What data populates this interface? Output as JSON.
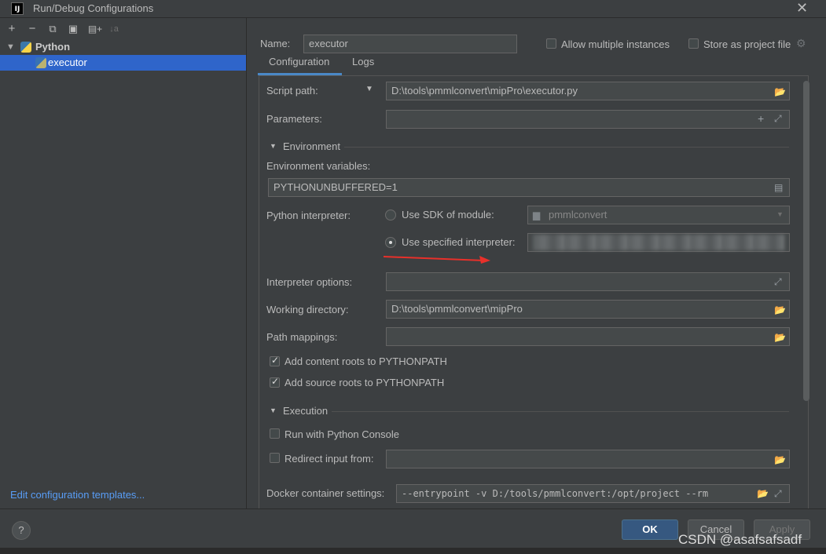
{
  "window": {
    "title": "Run/Debug Configurations",
    "app_icon": "IJ"
  },
  "toolbar": {
    "add": "+",
    "remove": "−",
    "copy": "⧉",
    "save": "▣",
    "folder": "▤+",
    "sort": "↓a"
  },
  "tree": {
    "group": "Python",
    "item": "executor"
  },
  "left_footer": {
    "edit_templates": "Edit configuration templates..."
  },
  "name": {
    "label": "Name:",
    "value": "executor"
  },
  "allow_multiple": {
    "label": "Allow multiple instances",
    "checked": false
  },
  "store_project": {
    "label": "Store as project file",
    "checked": false
  },
  "tabs": [
    {
      "label": "Configuration"
    },
    {
      "label": "Logs"
    }
  ],
  "script": {
    "label": "Script path:",
    "value": "D:\\tools\\pmmlconvert\\mipPro\\executor.py"
  },
  "params": {
    "label": "Parameters:",
    "value": ""
  },
  "env_section": {
    "title": "Environment"
  },
  "env_vars": {
    "label": "Environment variables:",
    "value": "PYTHONUNBUFFERED=1"
  },
  "interpreter": {
    "label": "Python interpreter:",
    "sdk_option": "Use SDK of module:",
    "sdk_value": "pmmlconvert",
    "specified_option": "Use specified interpreter:",
    "selected": "specified"
  },
  "interp_options": {
    "label": "Interpreter options:",
    "value": ""
  },
  "working_dir": {
    "label": "Working directory:",
    "value": "D:\\tools\\pmmlconvert\\mipPro"
  },
  "path_mappings": {
    "label": "Path mappings:",
    "value": ""
  },
  "content_roots": {
    "label": "Add content roots to PYTHONPATH",
    "checked": true
  },
  "source_roots": {
    "label": "Add source roots to PYTHONPATH",
    "checked": true
  },
  "exec_section": {
    "title": "Execution"
  },
  "python_console": {
    "label": "Run with Python Console",
    "checked": false
  },
  "redirect_input": {
    "label": "Redirect input from:",
    "value": "",
    "checked": false
  },
  "docker": {
    "label": "Docker container settings:",
    "value": "--entrypoint -v D:/tools/pmmlconvert:/opt/project --rm"
  },
  "buttons": {
    "ok": "OK",
    "cancel": "Cancel",
    "apply": "Apply",
    "help": "?"
  },
  "watermark": "CSDN @asafsafsadf",
  "colors": {
    "accent": "#2f65ca",
    "link": "#589df6",
    "arrow": "#e8302a",
    "ok_button": "#365880"
  }
}
